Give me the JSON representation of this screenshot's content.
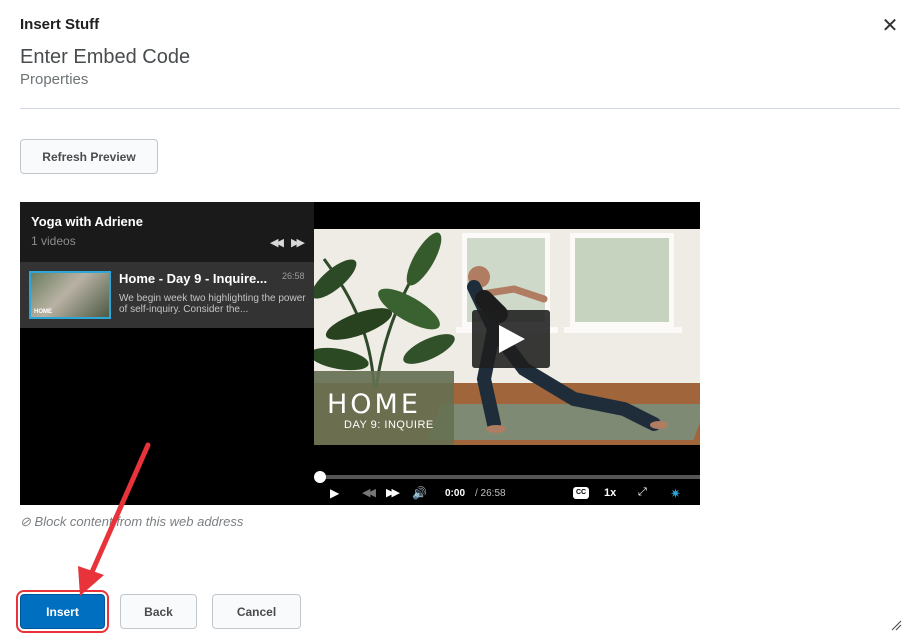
{
  "dialog": {
    "title": "Insert Stuff",
    "close_icon": "close-icon",
    "heading": "Enter Embed Code",
    "subheading": "Properties"
  },
  "toolbar": {
    "refresh_label": "Refresh Preview"
  },
  "player": {
    "playlist": {
      "channel": "Yoga with Adriene",
      "count": "1 videos",
      "items": [
        {
          "title": "Home - Day 9 - Inquire...",
          "duration": "26:58",
          "description": "We begin week two highlighting the power of self-inquiry. Consider the...",
          "thumb_label": "HOME"
        }
      ]
    },
    "video": {
      "overlay_title": "HOME",
      "overlay_subtitle": "DAY 9: INQUIRE"
    },
    "controls": {
      "current_time": "0:00",
      "duration": "/ 26:58",
      "speed": "1x",
      "cc_label": "CC",
      "progress": 0
    }
  },
  "block_link": "Block content from this web address",
  "footer": {
    "insert_label": "Insert",
    "back_label": "Back",
    "cancel_label": "Cancel"
  },
  "colors": {
    "primary": "#006fbf",
    "annotation": "#e8333b",
    "accent": "#2ea6d8"
  }
}
